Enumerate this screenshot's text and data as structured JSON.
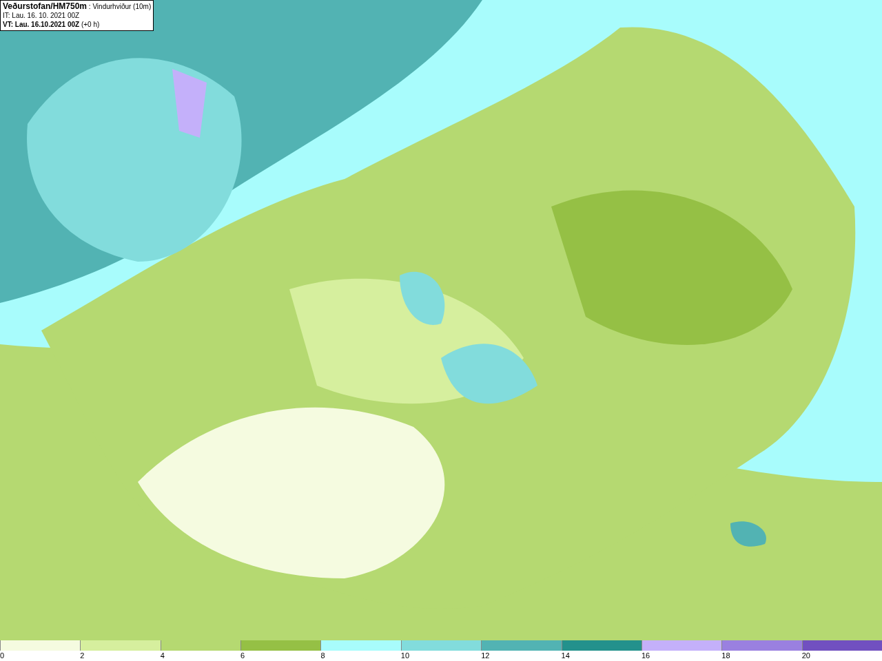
{
  "title_box": {
    "lines": [
      "**Veðurstofan/HM750m** : Vindurhviður (10m)",
      "IT: Lau. 16. 10. 2021 00Z",
      "**VT: Lau. 16.10.2021 00Z** (+0 h)"
    ]
  },
  "legend": {
    "bins": [
      {
        "color": "#f5fbe0",
        "tick": "0"
      },
      {
        "color": "#d6ef9e",
        "tick": "2"
      },
      {
        "color": "#b5d971",
        "tick": "4"
      },
      {
        "color": "#95c045",
        "tick": "6"
      },
      {
        "color": "#a8fcfc",
        "tick": "8"
      },
      {
        "color": "#82dcdc",
        "tick": "10"
      },
      {
        "color": "#52b3b3",
        "tick": "12"
      },
      {
        "color": "#23918c",
        "tick": "14"
      },
      {
        "color": "#c4b0fa",
        "tick": "16"
      },
      {
        "color": "#9a80e0",
        "tick": "18"
      },
      {
        "color": "#7150c0",
        "tick": "20"
      }
    ]
  }
}
